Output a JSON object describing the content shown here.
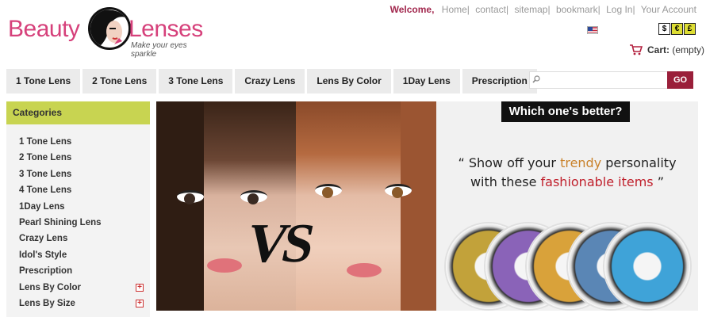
{
  "header": {
    "logo": {
      "word_left": "Beauty",
      "word_right": "Lenses",
      "tagline": "Make your eyes sparkle"
    },
    "top_links": {
      "welcome": "Welcome,",
      "links": [
        "Home",
        "contact",
        "sitemap",
        "bookmark",
        "Log In",
        "Your Account"
      ],
      "separator": "|"
    },
    "currency": {
      "options": [
        "$",
        "€",
        "£"
      ],
      "selected": "$"
    },
    "cart": {
      "label": "Cart:",
      "status": "(empty)"
    }
  },
  "nav": {
    "tabs": [
      "1 Tone Lens",
      "2 Tone Lens",
      "3 Tone Lens",
      "Crazy Lens",
      "Lens By Color",
      "1Day Lens",
      "Prescription"
    ]
  },
  "search": {
    "value": "",
    "button": "GO"
  },
  "sidebar": {
    "heading": "Categories",
    "items": [
      {
        "label": "1 Tone Lens",
        "expandable": false
      },
      {
        "label": "2 Tone Lens",
        "expandable": false
      },
      {
        "label": "3 Tone Lens",
        "expandable": false
      },
      {
        "label": "4 Tone Lens",
        "expandable": false
      },
      {
        "label": "1Day Lens",
        "expandable": false
      },
      {
        "label": "Pearl Shining Lens",
        "expandable": false
      },
      {
        "label": "Crazy Lens",
        "expandable": false
      },
      {
        "label": "Idol's Style",
        "expandable": false
      },
      {
        "label": "Prescription",
        "expandable": false
      },
      {
        "label": "Lens By Color",
        "expandable": true
      },
      {
        "label": "Lens By Size",
        "expandable": true
      }
    ],
    "expand_glyph": "+"
  },
  "banner": {
    "vs_text": "VS",
    "which_title": "Which one's better?",
    "quote_open": "“",
    "quote_part1": " Show off your ",
    "quote_highlight1": "trendy",
    "quote_part2": " personality",
    "quote_part3": "with these ",
    "quote_highlight2": "fashionable items",
    "quote_close": " ”",
    "lens_colors": [
      "#c2a23a",
      "#8a63b8",
      "#d9a23a",
      "#5a86b5",
      "#3fa3d8"
    ]
  },
  "colors": {
    "brand_pink": "#d6417b",
    "welcome": "#a2284e",
    "category_header": "#c8d451",
    "go_button": "#9a1f3a"
  }
}
